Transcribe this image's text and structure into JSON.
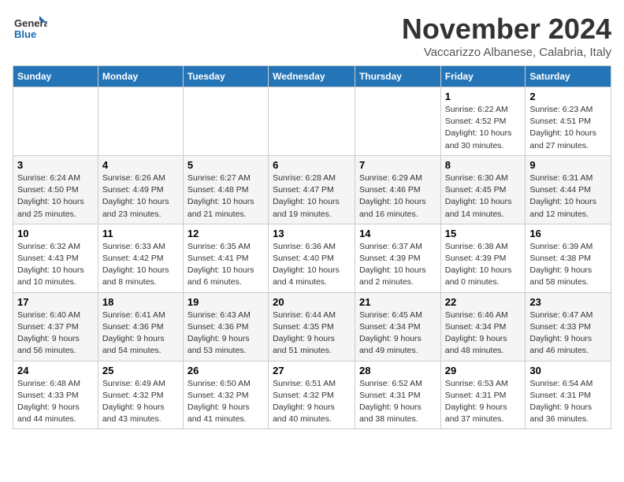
{
  "logo": {
    "line1": "General",
    "line2": "Blue"
  },
  "title": "November 2024",
  "subtitle": "Vaccarizzo Albanese, Calabria, Italy",
  "days_of_week": [
    "Sunday",
    "Monday",
    "Tuesday",
    "Wednesday",
    "Thursday",
    "Friday",
    "Saturday"
  ],
  "weeks": [
    [
      {
        "day": "",
        "info": ""
      },
      {
        "day": "",
        "info": ""
      },
      {
        "day": "",
        "info": ""
      },
      {
        "day": "",
        "info": ""
      },
      {
        "day": "",
        "info": ""
      },
      {
        "day": "1",
        "info": "Sunrise: 6:22 AM\nSunset: 4:52 PM\nDaylight: 10 hours and 30 minutes."
      },
      {
        "day": "2",
        "info": "Sunrise: 6:23 AM\nSunset: 4:51 PM\nDaylight: 10 hours and 27 minutes."
      }
    ],
    [
      {
        "day": "3",
        "info": "Sunrise: 6:24 AM\nSunset: 4:50 PM\nDaylight: 10 hours and 25 minutes."
      },
      {
        "day": "4",
        "info": "Sunrise: 6:26 AM\nSunset: 4:49 PM\nDaylight: 10 hours and 23 minutes."
      },
      {
        "day": "5",
        "info": "Sunrise: 6:27 AM\nSunset: 4:48 PM\nDaylight: 10 hours and 21 minutes."
      },
      {
        "day": "6",
        "info": "Sunrise: 6:28 AM\nSunset: 4:47 PM\nDaylight: 10 hours and 19 minutes."
      },
      {
        "day": "7",
        "info": "Sunrise: 6:29 AM\nSunset: 4:46 PM\nDaylight: 10 hours and 16 minutes."
      },
      {
        "day": "8",
        "info": "Sunrise: 6:30 AM\nSunset: 4:45 PM\nDaylight: 10 hours and 14 minutes."
      },
      {
        "day": "9",
        "info": "Sunrise: 6:31 AM\nSunset: 4:44 PM\nDaylight: 10 hours and 12 minutes."
      }
    ],
    [
      {
        "day": "10",
        "info": "Sunrise: 6:32 AM\nSunset: 4:43 PM\nDaylight: 10 hours and 10 minutes."
      },
      {
        "day": "11",
        "info": "Sunrise: 6:33 AM\nSunset: 4:42 PM\nDaylight: 10 hours and 8 minutes."
      },
      {
        "day": "12",
        "info": "Sunrise: 6:35 AM\nSunset: 4:41 PM\nDaylight: 10 hours and 6 minutes."
      },
      {
        "day": "13",
        "info": "Sunrise: 6:36 AM\nSunset: 4:40 PM\nDaylight: 10 hours and 4 minutes."
      },
      {
        "day": "14",
        "info": "Sunrise: 6:37 AM\nSunset: 4:39 PM\nDaylight: 10 hours and 2 minutes."
      },
      {
        "day": "15",
        "info": "Sunrise: 6:38 AM\nSunset: 4:39 PM\nDaylight: 10 hours and 0 minutes."
      },
      {
        "day": "16",
        "info": "Sunrise: 6:39 AM\nSunset: 4:38 PM\nDaylight: 9 hours and 58 minutes."
      }
    ],
    [
      {
        "day": "17",
        "info": "Sunrise: 6:40 AM\nSunset: 4:37 PM\nDaylight: 9 hours and 56 minutes."
      },
      {
        "day": "18",
        "info": "Sunrise: 6:41 AM\nSunset: 4:36 PM\nDaylight: 9 hours and 54 minutes."
      },
      {
        "day": "19",
        "info": "Sunrise: 6:43 AM\nSunset: 4:36 PM\nDaylight: 9 hours and 53 minutes."
      },
      {
        "day": "20",
        "info": "Sunrise: 6:44 AM\nSunset: 4:35 PM\nDaylight: 9 hours and 51 minutes."
      },
      {
        "day": "21",
        "info": "Sunrise: 6:45 AM\nSunset: 4:34 PM\nDaylight: 9 hours and 49 minutes."
      },
      {
        "day": "22",
        "info": "Sunrise: 6:46 AM\nSunset: 4:34 PM\nDaylight: 9 hours and 48 minutes."
      },
      {
        "day": "23",
        "info": "Sunrise: 6:47 AM\nSunset: 4:33 PM\nDaylight: 9 hours and 46 minutes."
      }
    ],
    [
      {
        "day": "24",
        "info": "Sunrise: 6:48 AM\nSunset: 4:33 PM\nDaylight: 9 hours and 44 minutes."
      },
      {
        "day": "25",
        "info": "Sunrise: 6:49 AM\nSunset: 4:32 PM\nDaylight: 9 hours and 43 minutes."
      },
      {
        "day": "26",
        "info": "Sunrise: 6:50 AM\nSunset: 4:32 PM\nDaylight: 9 hours and 41 minutes."
      },
      {
        "day": "27",
        "info": "Sunrise: 6:51 AM\nSunset: 4:32 PM\nDaylight: 9 hours and 40 minutes."
      },
      {
        "day": "28",
        "info": "Sunrise: 6:52 AM\nSunset: 4:31 PM\nDaylight: 9 hours and 38 minutes."
      },
      {
        "day": "29",
        "info": "Sunrise: 6:53 AM\nSunset: 4:31 PM\nDaylight: 9 hours and 37 minutes."
      },
      {
        "day": "30",
        "info": "Sunrise: 6:54 AM\nSunset: 4:31 PM\nDaylight: 9 hours and 36 minutes."
      }
    ]
  ]
}
